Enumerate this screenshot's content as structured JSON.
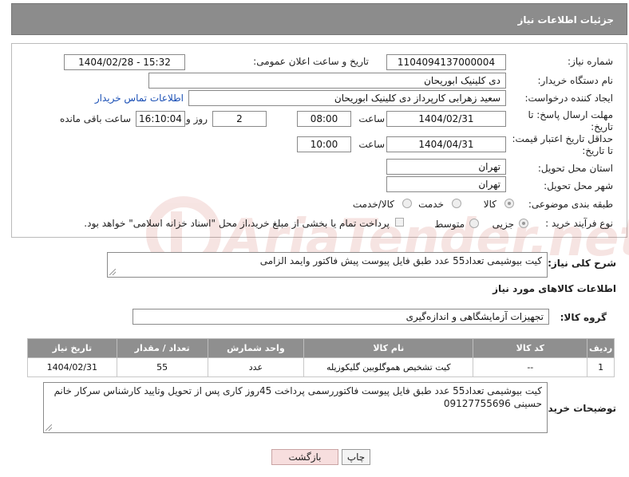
{
  "header": {
    "title": "جزئیات اطلاعات نیاز"
  },
  "form": {
    "need_number_label": "شماره نیاز:",
    "need_number": "1104094137000004",
    "announce_label": "تاریخ و ساعت اعلان عمومی:",
    "announce_value": "1404/02/28 - 15:32",
    "buyer_org_label": "نام دستگاه خریدار:",
    "buyer_org": "دی کلینیک ابوریحان",
    "creator_label": "ایجاد کننده درخواست:",
    "creator": "سعید زهرابی کارپرداز دی کلینیک ابوریحان",
    "contact_link": "اطلاعات تماس خریدار",
    "deadline_label_1": "مهلت ارسال پاسخ: تا",
    "deadline_label_2": "تاریخ:",
    "deadline_date": "1404/02/31",
    "time_label": "ساعت",
    "deadline_time": "08:00",
    "days_value": "2",
    "days_label": "روز و",
    "remaining_time": "16:10:04",
    "remaining_label": "ساعت باقی مانده",
    "price_valid_label_1": "حداقل تاریخ اعتبار قیمت:",
    "price_valid_label_2": "تا تاریخ:",
    "price_valid_date": "1404/04/31",
    "price_valid_time_label": "ساعت",
    "price_valid_time": "10:00",
    "province_label": "استان محل تحویل:",
    "province": "تهران",
    "city_label": "شهر محل تحویل:",
    "city": "تهران",
    "category_label": "طبقه بندی موضوعی:",
    "category_options": [
      "کالا",
      "خدمت",
      "کالا/خدمت"
    ],
    "process_label": "نوع فرآیند خرید :",
    "process_options": [
      "جزیی",
      "متوسط"
    ],
    "payment_note": "پرداخت تمام یا بخشی از مبلغ خرید،از محل \"اسناد خزانه اسلامی\" خواهد بود."
  },
  "summary": {
    "label": "شرح کلی نیاز:",
    "text": "کیت بیوشیمی تعداد55 عدد طبق فایل پیوست پیش فاکتور وایمد الزامی"
  },
  "goods": {
    "section_title": "اطلاعات کالاهای مورد نیاز",
    "group_label": "گروه کالا:",
    "group_value": "تجهیزات آزمایشگاهی و اندازه‌گیری",
    "columns": [
      "ردیف",
      "کد کالا",
      "نام کالا",
      "واحد شمارش",
      "تعداد / مقدار",
      "تاریخ نیاز"
    ],
    "rows": [
      [
        "1",
        "--",
        "کیت تشخیص هموگلوبین گلیکوزیله",
        "عدد",
        "55",
        "1404/02/31"
      ]
    ]
  },
  "buyer_notes": {
    "label": "توضیحات خریدار:",
    "text": "کیت بیوشیمی تعداد55 عدد طبق فایل پیوست فاکتوررسمی پرداخت 45روز کاری پس از تحویل وتایید کارشناس سرکار خانم حسینی 09127755696"
  },
  "buttons": {
    "print": "چاپ",
    "back": "بازگشت"
  },
  "watermark": {
    "text": "AriaTender.net"
  },
  "colors": {
    "header_bg": "#8c8c8c",
    "link": "#1a4fb5",
    "back_button_bg": "#f7dede"
  }
}
